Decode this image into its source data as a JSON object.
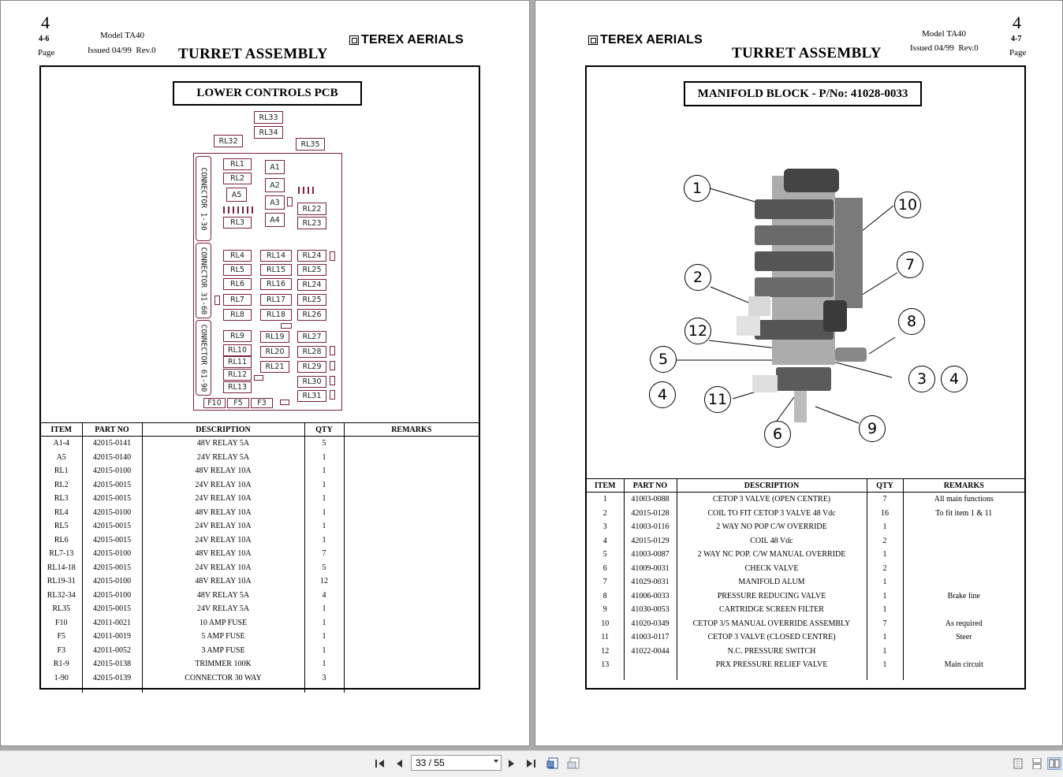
{
  "left_page": {
    "section_number": "4",
    "page_number": "4-6",
    "page_label": "Page",
    "model": "Model TA40",
    "issued": "Issued 04/99  Rev.0",
    "title": "TURRET ASSEMBLY",
    "brand": "TEREX AERIALS",
    "diagram_title": "LOWER CONTROLS PCB",
    "pcb": {
      "relays": [
        "RL33",
        "RL34",
        "RL32",
        "RL35",
        "RL1",
        "RL2",
        "A5",
        "RL3",
        "A1",
        "A2",
        "A3",
        "A4",
        "RL22",
        "RL23",
        "RL4",
        "RL5",
        "RL6",
        "RL7",
        "RL8",
        "RL14",
        "RL15",
        "RL16",
        "RL17",
        "RL18",
        "RL24",
        "RL25",
        "RL24",
        "RL25",
        "RL26",
        "RL9",
        "RL10",
        "RL11",
        "RL12",
        "RL13",
        "RL19",
        "RL20",
        "RL21",
        "RL27",
        "RL28",
        "RL29",
        "RL30",
        "RL31"
      ],
      "fuses": [
        "F10",
        "F5",
        "F3"
      ],
      "connectors": [
        "CONNECTOR 1-30",
        "CONNECTOR 31-60",
        "CONNECTOR 61-90"
      ]
    },
    "table": {
      "headers": [
        "ITEM",
        "PART NO",
        "DESCRIPTION",
        "QTY",
        "REMARKS"
      ],
      "rows": [
        [
          "A1-4",
          "42015-0141",
          "48V RELAY 5A",
          "5",
          ""
        ],
        [
          "A5",
          "42015-0140",
          "24V RELAY 5A",
          "1",
          ""
        ],
        [
          "RL1",
          "42015-0100",
          "48V RELAY 10A",
          "1",
          ""
        ],
        [
          "RL2",
          "42015-0015",
          "24V RELAY 10A",
          "1",
          ""
        ],
        [
          "RL3",
          "42015-0015",
          "24V RELAY 10A",
          "1",
          ""
        ],
        [
          "RL4",
          "42015-0100",
          "48V RELAY 10A",
          "1",
          ""
        ],
        [
          "RL5",
          "42015-0015",
          "24V RELAY 10A",
          "1",
          ""
        ],
        [
          "RL6",
          "42015-0015",
          "24V RELAY 10A",
          "1",
          ""
        ],
        [
          "RL7-13",
          "42015-0100",
          "48V RELAY 10A",
          "7",
          ""
        ],
        [
          "RL14-18",
          "42015-0015",
          "24V RELAY 10A",
          "5",
          ""
        ],
        [
          "RL19-31",
          "42015-0100",
          "48V RELAY 10A",
          "12",
          ""
        ],
        [
          "RL32-34",
          "42015-0100",
          "48V RELAY 5A",
          "4",
          ""
        ],
        [
          "RL35",
          "42015-0015",
          "24V RELAY 5A",
          "1",
          ""
        ],
        [
          "F10",
          "42011-0021",
          "10 AMP FUSE",
          "1",
          ""
        ],
        [
          "F5",
          "42011-0019",
          "5 AMP FUSE",
          "1",
          ""
        ],
        [
          "F3",
          "42011-0052",
          "3 AMP FUSE",
          "1",
          ""
        ],
        [
          "R1-9",
          "42015-0138",
          "TRIMMER 100K",
          "1",
          ""
        ],
        [
          "1-90",
          "42015-0139",
          "CONNECTOR 30 WAY",
          "3",
          ""
        ]
      ]
    }
  },
  "right_page": {
    "section_number": "4",
    "page_number": "4-7",
    "page_label": "Page",
    "model": "Model TA40",
    "issued": "Issued 04/99  Rev.0",
    "title": "TURRET ASSEMBLY",
    "brand": "TEREX AERIALS",
    "diagram_title": "MANIFOLD BLOCK - P/No: 41028-0033",
    "callouts": [
      "1",
      "10",
      "2",
      "7",
      "12",
      "8",
      "5",
      "3",
      "4",
      "4",
      "11",
      "6",
      "9"
    ],
    "table": {
      "headers": [
        "ITEM",
        "PART NO",
        "DESCRIPTION",
        "QTY",
        "REMARKS"
      ],
      "rows": [
        [
          "1",
          "41003-0088",
          "CETOP 3 VALVE (OPEN CENTRE)",
          "7",
          "All main functions"
        ],
        [
          "2",
          "42015-0128",
          "COIL TO FIT CETOP 3 VALVE 48 Vdc",
          "16",
          "To fit item 1 & 11"
        ],
        [
          "3",
          "41003-0116",
          "2 WAY NO POP C/W OVERRIDE",
          "1",
          ""
        ],
        [
          "4",
          "42015-0129",
          "COIL 48 Vdc",
          "2",
          ""
        ],
        [
          "5",
          "41003-0087",
          "2 WAY NC POP. C/W MANUAL OVERRIDE",
          "1",
          ""
        ],
        [
          "6",
          "41009-0031",
          "CHECK VALVE",
          "2",
          ""
        ],
        [
          "7",
          "41029-0031",
          "MANIFOLD ALUM",
          "1",
          ""
        ],
        [
          "8",
          "41006-0033",
          "PRESSURE REDUCING VALVE",
          "1",
          "Brake line"
        ],
        [
          "9",
          "41030-0053",
          "CARTRIDGE SCREEN FILTER",
          "1",
          ""
        ],
        [
          "10",
          "41020-0349",
          "CETOP 3/5 MANUAL OVERRIDE ASSEMBLY",
          "7",
          "As required"
        ],
        [
          "11",
          "41003-0117",
          "CETOP 3 VALVE (CLOSED CENTRE)",
          "1",
          "Steer"
        ],
        [
          "12",
          "41022-0044",
          "N.C. PRESSURE SWITCH",
          "1",
          ""
        ],
        [
          "13",
          "",
          "PRX PRESSURE RELIEF VALVE",
          "1",
          "Main circuit"
        ]
      ]
    }
  },
  "toolbar": {
    "page_indicator": "33 / 55",
    "icons": [
      "first-page-icon",
      "prev-page-icon",
      "next-page-icon",
      "last-page-icon",
      "fit-page-icon",
      "fit-width-icon",
      "single-page-icon",
      "continuous-icon",
      "two-page-icon"
    ]
  }
}
